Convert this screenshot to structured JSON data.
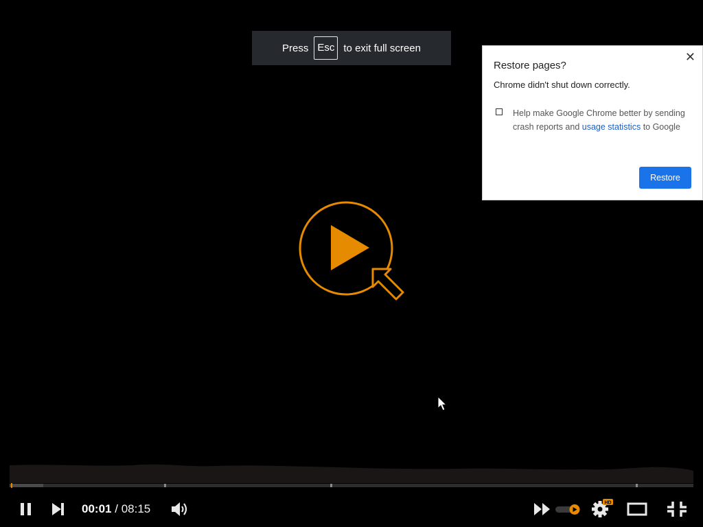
{
  "fullscreen_notice": {
    "prefix": "Press",
    "key": "Esc",
    "suffix": "to exit full screen"
  },
  "restore_dialog": {
    "close_glyph": "✕",
    "title": "Restore pages?",
    "message": "Chrome didn't shut down correctly.",
    "checkbox_checked": false,
    "checkbox_text_before_link": "Help make Google Chrome better by sending crash reports and ",
    "checkbox_link": "usage statistics",
    "checkbox_text_after_link": " to Google",
    "restore_button": "Restore"
  },
  "player": {
    "accent_color": "#e68a00",
    "current_time": "00:01",
    "separator": "/",
    "duration": "08:15",
    "progress_fraction": 0.002,
    "buffered_fraction": 0.049,
    "marker_positions_fraction": [
      0.226,
      0.469,
      0.916
    ],
    "quality_badge": "HD",
    "icons": [
      "pause-icon",
      "next-icon",
      "volume-icon",
      "fast-forward-icon",
      "autoplay-toggle",
      "settings-icon",
      "theater-mode-icon",
      "exit-fullscreen-icon",
      "big-play-icon"
    ]
  }
}
